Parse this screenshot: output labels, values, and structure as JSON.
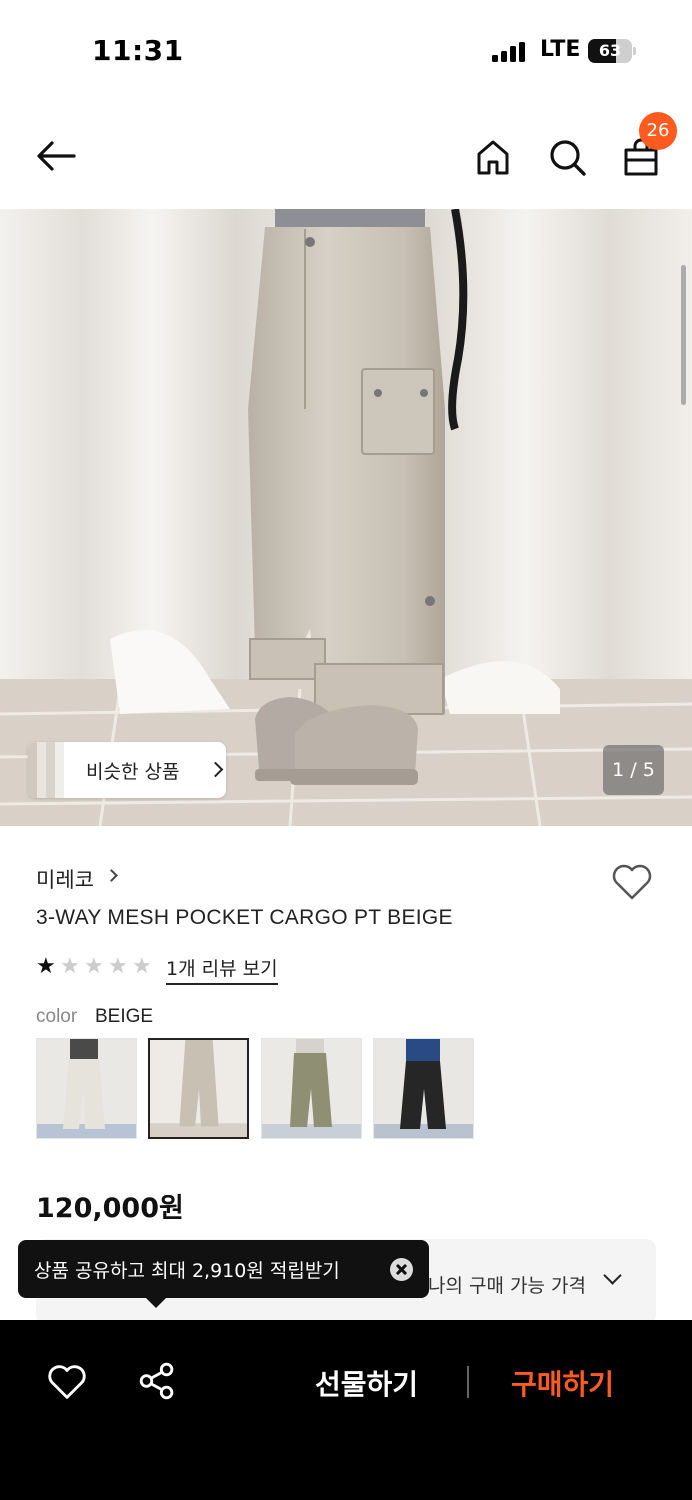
{
  "status_bar": {
    "time": "11:31",
    "network": "LTE",
    "battery": "63",
    "battery_level": 0.63
  },
  "header": {
    "cart_count": "26",
    "icons": [
      "back-arrow-icon",
      "home-icon",
      "search-icon",
      "shopping-bag-icon"
    ]
  },
  "gallery": {
    "similar_label": "비슷한 상품",
    "counter": "1 / 5"
  },
  "product": {
    "brand": "미레코",
    "title": "3-WAY MESH POCKET CARGO PT BEIGE",
    "rating": 1,
    "rating_max": 5,
    "review_link": "1개 리뷰 보기",
    "color_label": "color",
    "color_value": "BEIGE",
    "swatch_colors": [
      "#e6e3dc",
      "#c8c0b2",
      "#8f8f74",
      "#262626"
    ],
    "price": "120,000원"
  },
  "price_box": {
    "label": "나의 구매 가능 가격"
  },
  "tooltip": {
    "text": "상품 공유하고 최대 2,910원 적립받기"
  },
  "bottom_bar": {
    "gift_label": "선물하기",
    "buy_label": "구매하기",
    "buy_color": "#ff5a1f"
  }
}
